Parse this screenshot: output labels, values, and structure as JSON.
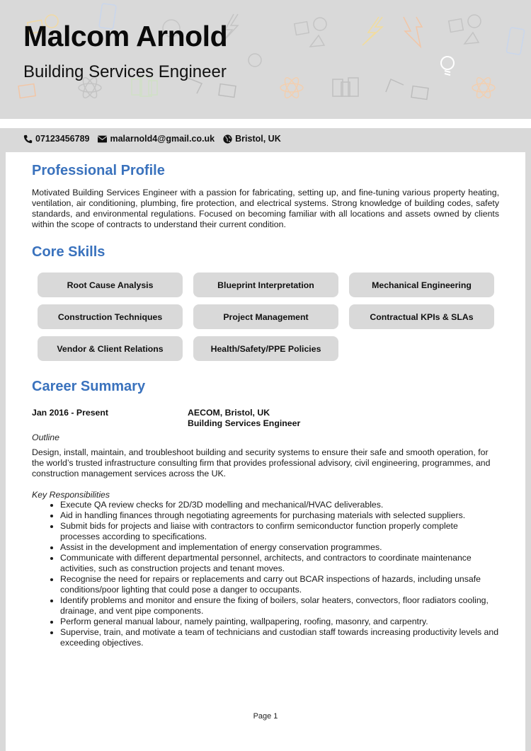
{
  "header": {
    "name": "Malcom Arnold",
    "title": "Building Services Engineer"
  },
  "contact": {
    "phone": "07123456789",
    "email": "malarnold4@gmail.co.uk",
    "location": "Bristol, UK",
    "phone_icon": "phone-icon",
    "email_icon": "envelope-icon",
    "location_icon": "globe-icon"
  },
  "profile": {
    "heading": "Professional Profile",
    "text": "Motivated Building Services Engineer with a passion for fabricating, setting up, and fine-tuning various property heating, ventilation, air conditioning, plumbing, fire protection, and electrical systems. Strong knowledge of building codes, safety standards, and environmental regulations. Focused on becoming familiar with all locations and assets owned by clients within the scope of contracts to understand their current condition."
  },
  "skills": {
    "heading": "Core Skills",
    "items": [
      "Root Cause Analysis",
      "Blueprint Interpretation",
      "Mechanical Engineering",
      "Construction Techniques",
      "Project Management",
      "Contractual KPIs & SLAs",
      "Vendor & Client Relations",
      "Health/Safety/PPE Policies"
    ]
  },
  "career": {
    "heading": "Career Summary",
    "jobs": [
      {
        "dates": "Jan 2016 - Present",
        "company": "AECOM, Bristol, UK",
        "role": "Building Services Engineer",
        "outline_label": "Outline",
        "outline": "Design, install, maintain, and troubleshoot building and security systems to ensure their safe and smooth operation, for the world’s trusted infrastructure consulting firm that provides professional advisory, civil engineering, programmes, and construction management services across the UK.",
        "resp_label": "Key Responsibilities",
        "responsibilities": [
          "Execute QA review checks for 2D/3D modelling and mechanical/HVAC deliverables.",
          "Aid in handling finances through negotiating agreements for purchasing materials with selected suppliers.",
          "Submit bids for projects and liaise with contractors to confirm semiconductor function properly complete processes according to specifications.",
          "Assist in the development and implementation of energy conservation programmes.",
          "Communicate with different departmental personnel, architects, and contractors to coordinate maintenance activities, such as construction projects and tenant moves.",
          "Recognise the need for repairs or replacements and carry out BCAR inspections of hazards, including unsafe conditions/poor lighting that could pose a danger to occupants.",
          "Identify problems and monitor and ensure the fixing of boilers, solar heaters, convectors, floor radiators cooling, drainage, and vent pipe components.",
          "Perform general manual labour, namely painting, wallpapering, roofing, masonry, and carpentry.",
          "Supervise, train, and motivate a team of technicians and custodian staff towards increasing productivity levels and exceeding objectives."
        ]
      }
    ]
  },
  "footer": {
    "page_label": "Page 1"
  }
}
